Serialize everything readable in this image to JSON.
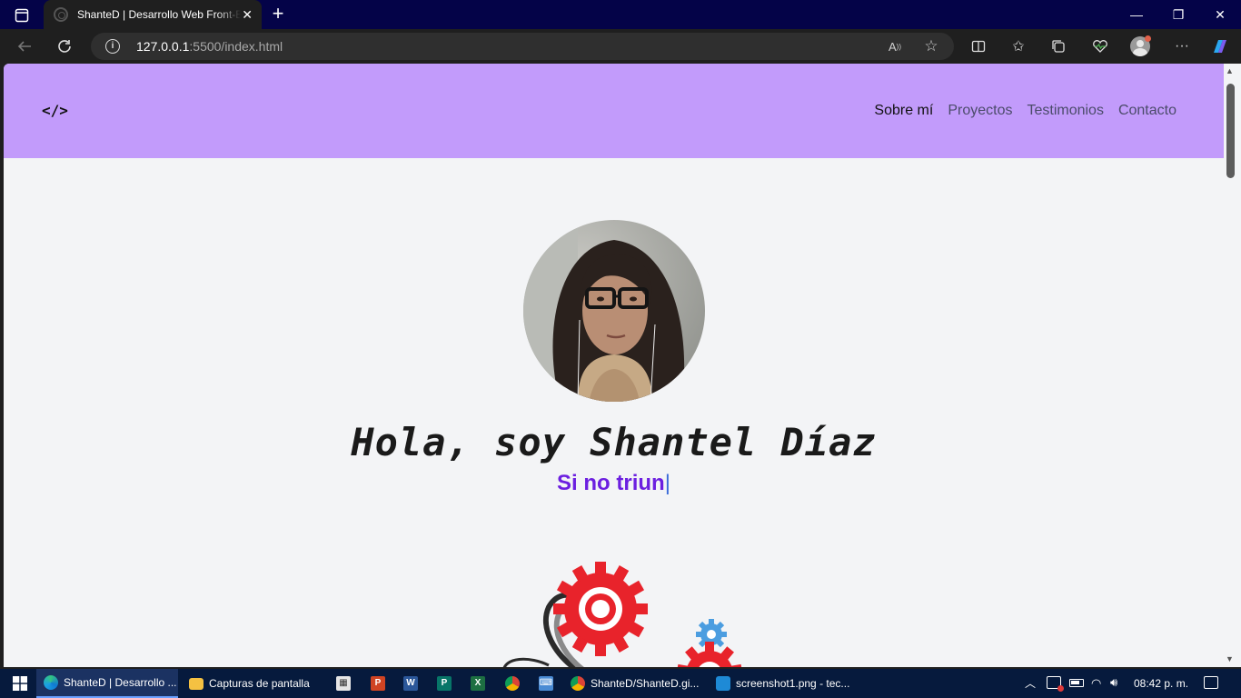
{
  "browser": {
    "tab_title": "ShanteD | Desarrollo Web Front-End",
    "url_host": "127.0.0.1",
    "url_rest": ":5500/index.html"
  },
  "site": {
    "logo": "</>",
    "nav": [
      "Sobre mí",
      "Proyectos",
      "Testimonios",
      "Contacto"
    ],
    "headline": "Hola, soy Shantel Díaz",
    "typed_text": "Si no triun",
    "cursor": "|",
    "header_color": "#c29bfb",
    "accent_color": "#6c1fe0"
  },
  "taskbar": {
    "items": [
      {
        "label": "ShanteD | Desarrollo ...",
        "icon": "edge-icon"
      },
      {
        "label": "Capturas de pantalla",
        "icon": "folder-icon"
      },
      {
        "label": "ShanteD/ShanteD.gi...",
        "icon": "chrome-icon"
      },
      {
        "label": "screenshot1.png - tec...",
        "icon": "vscode-icon"
      }
    ],
    "clock": "08:42 p. m."
  }
}
